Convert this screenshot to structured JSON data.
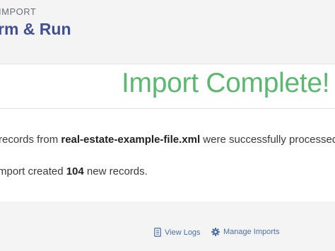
{
  "header": {
    "eyebrow": "IMPORT",
    "title": "rm & Run"
  },
  "result": {
    "heading": "Import Complete!",
    "line1": {
      "prefix": "records from ",
      "filename": "real-estate-example-file.xml",
      "suffix": " were successfully processed."
    },
    "line2": {
      "prefix": "mport created ",
      "count": "104",
      "suffix": " new records."
    },
    "heading_color": "#5cb870"
  },
  "footer": {
    "view_logs": {
      "label": "View Logs",
      "icon": "document-list-icon"
    },
    "manage_imports": {
      "label": "Manage Imports",
      "icon": "gear-icon"
    }
  }
}
